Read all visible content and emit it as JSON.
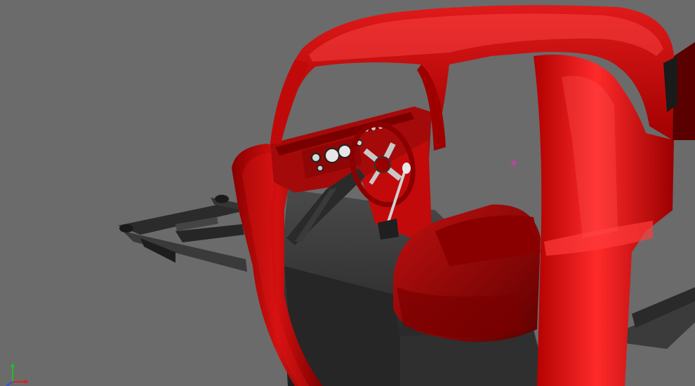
{
  "viewport": {
    "background_color": "#6b6b6b",
    "body_color": "#c40a0a",
    "body_highlight_color": "#ff3a3a",
    "interior_color": "#3a3a3a",
    "seat_color": "#a00000",
    "chassis_color": "#2e2e2e",
    "pivot_color": "#b04aa0"
  },
  "gizmo": {
    "icon": "axis-gizmo-icon",
    "x_color": "#e02020",
    "y_color": "#20c020",
    "z_color": "#3050e0"
  }
}
